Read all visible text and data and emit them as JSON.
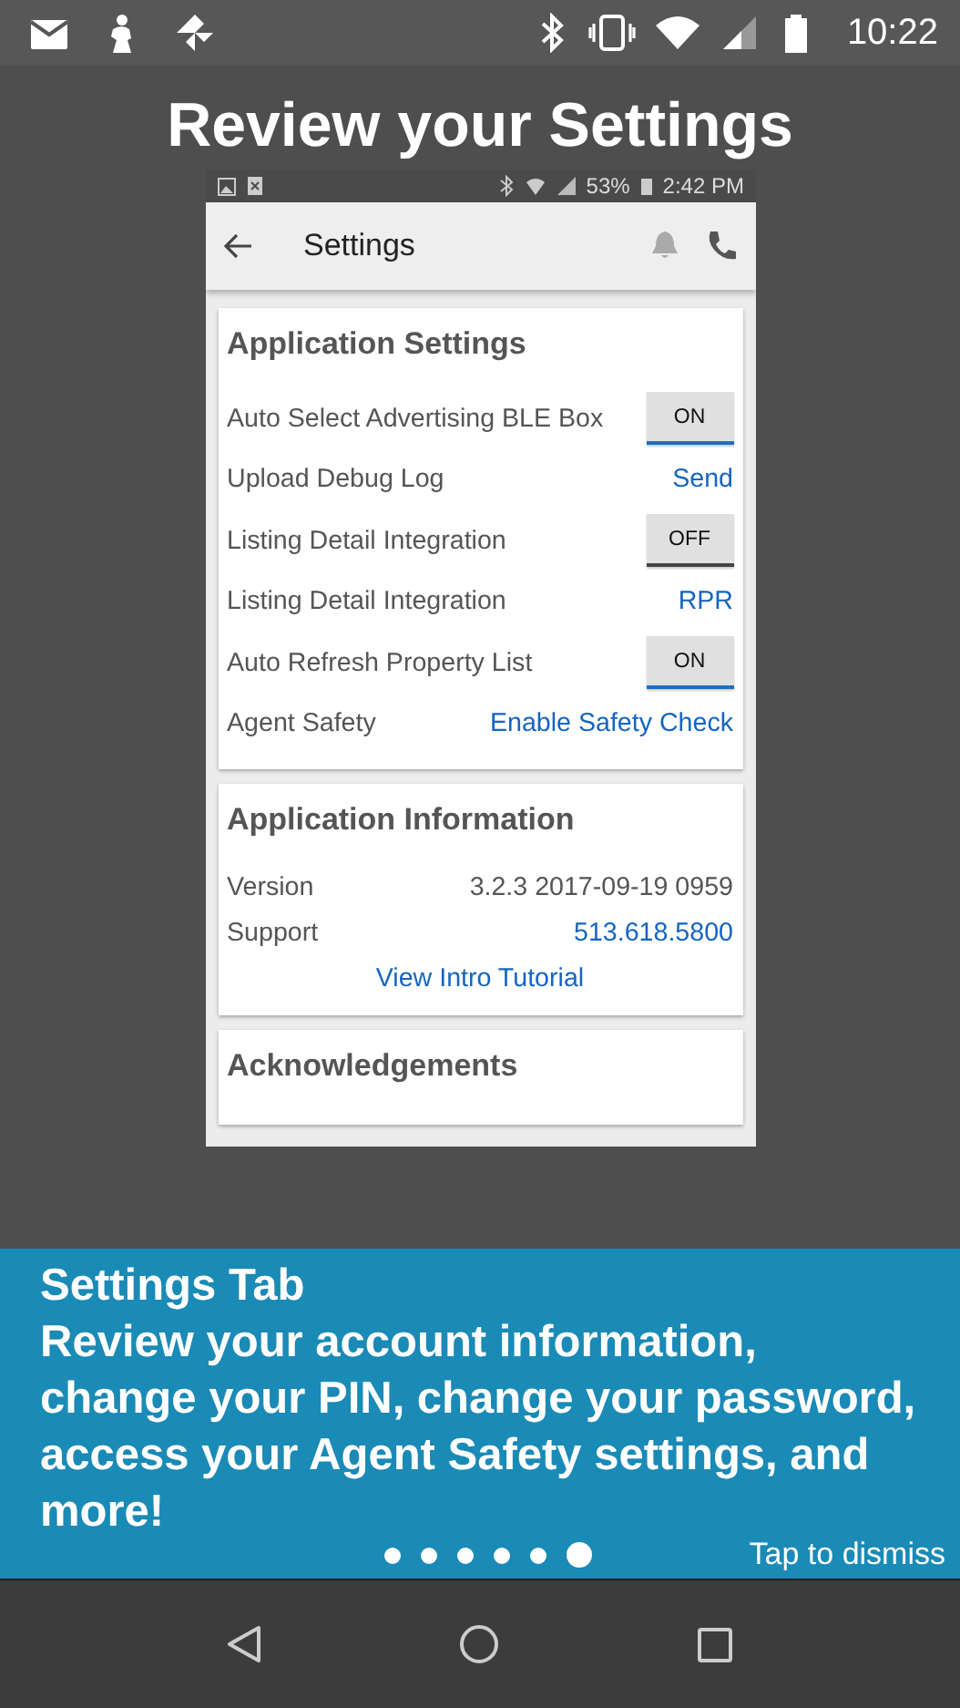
{
  "status_bar": {
    "time": "10:22"
  },
  "title": "Review your Settings",
  "phone": {
    "status_bar": {
      "battery": "53%",
      "time": "2:42 PM"
    },
    "app_bar": {
      "title": "Settings"
    },
    "cards": [
      {
        "title": "Application Settings",
        "rows": [
          {
            "kind": "toggle",
            "label": "Auto Select Advertising BLE Box",
            "value": "ON",
            "on": true
          },
          {
            "kind": "link",
            "label": "Upload Debug Log",
            "value": "Send"
          },
          {
            "kind": "toggle",
            "label": "Listing Detail Integration",
            "value": "OFF",
            "on": false
          },
          {
            "kind": "link",
            "label": "Listing Detail Integration",
            "value": "RPR"
          },
          {
            "kind": "toggle",
            "label": "Auto Refresh Property List",
            "value": "ON",
            "on": true
          },
          {
            "kind": "link",
            "label": "Agent Safety",
            "value": "Enable Safety Check"
          }
        ]
      },
      {
        "title": "Application Information",
        "rows": [
          {
            "kind": "text",
            "label": "Version",
            "value": "3.2.3 2017-09-19 0959"
          },
          {
            "kind": "link",
            "label": "Support",
            "value": "513.618.5800"
          },
          {
            "kind": "center_link",
            "value": "View Intro Tutorial"
          }
        ]
      },
      {
        "title": "Acknowledgements"
      }
    ]
  },
  "tip": {
    "heading": "Settings Tab",
    "message": "Review your account information, change your PIN, change your password, access your Agent Safety settings, and more!",
    "dismiss": "Tap to dismiss",
    "dots": [
      {
        "selected": false
      },
      {
        "selected": false
      },
      {
        "selected": false
      },
      {
        "selected": false
      },
      {
        "selected": false
      },
      {
        "selected": true
      }
    ]
  }
}
